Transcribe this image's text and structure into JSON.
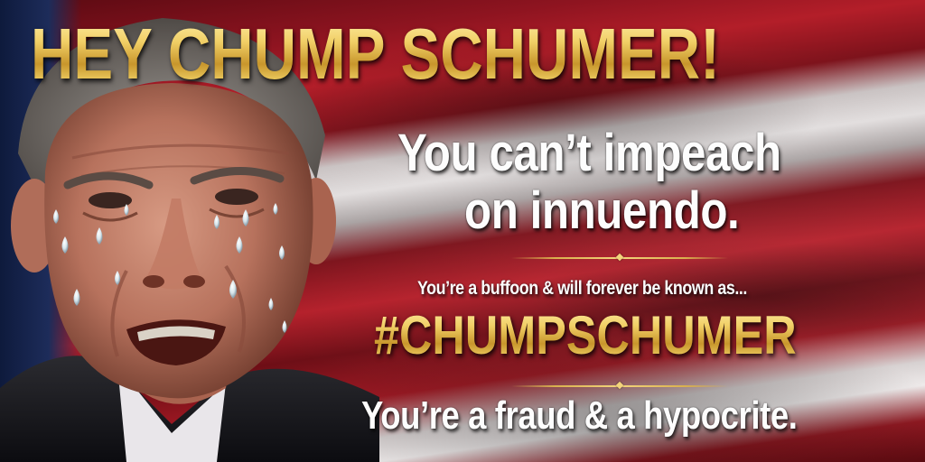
{
  "banner": {
    "headline": "HEY CHUMP SCHUMER!",
    "line_a": "You can’t impeach",
    "line_b": "on innuendo.",
    "tagline": "You’re a buffoon & will forever be known as...",
    "hashtag": "#CHUMPSCHUMER",
    "closing": "You’re a fraud & a hypocrite."
  },
  "colors": {
    "gold": "#e9c35a",
    "flag_red": "#b31e29",
    "flag_white": "#e2dede",
    "flag_blue": "#1d2c5a",
    "text_white": "#fdfdfd"
  },
  "image": {
    "subject_icon": "crying-man-portrait"
  }
}
